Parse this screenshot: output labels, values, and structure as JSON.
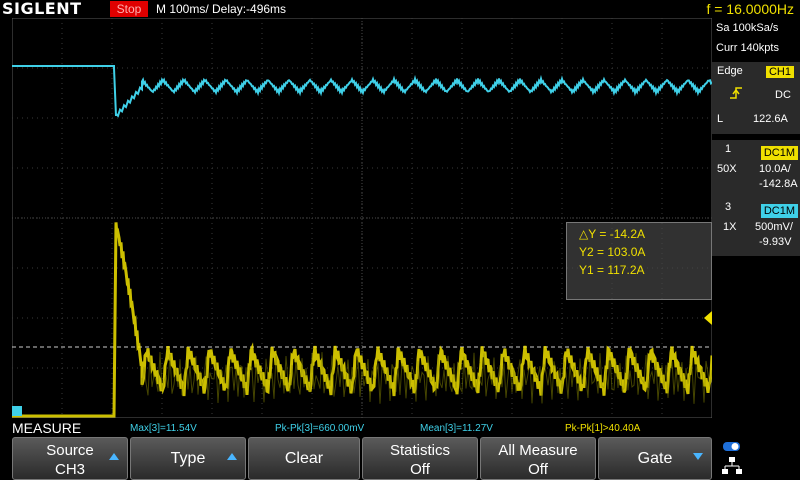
{
  "header": {
    "brand": "SIGLENT",
    "run_state": "Stop",
    "timebase": "M 100ms/  Delay:-496ms",
    "frequency": "f = 16.0000Hz"
  },
  "right_panel": {
    "sample_rate": "Sa 100kSa/s",
    "memory": "Curr 140kpts",
    "trigger": {
      "type": "Edge",
      "source": "CH1",
      "coupling": "DC",
      "level_label": "L",
      "level": "122.6A"
    },
    "ch1": {
      "number": "1",
      "coupling": "DC1M",
      "probe": "50X",
      "scale": "10.0A/",
      "offset": "-142.8A"
    },
    "ch3": {
      "number": "3",
      "coupling": "DC1M",
      "probe": "1X",
      "scale": "500mV/",
      "offset": "-9.93V"
    }
  },
  "cursor_readout": {
    "delta_y": "△Y = -14.2A",
    "y2": "Y2 = 103.0A",
    "y1": "Y1 = 117.2A"
  },
  "measure": {
    "title": "MEASURE",
    "items": [
      {
        "text": "Max[3]=11.54V",
        "color": "#3fd0e8"
      },
      {
        "text": "Pk-Pk[3]=660.00mV",
        "color": "#3fd0e8"
      },
      {
        "text": "Mean[3]=11.27V",
        "color": "#3fd0e8"
      },
      {
        "text": "Pk-Pk[1]>40.40A",
        "color": "#f0e000"
      }
    ]
  },
  "softkeys": {
    "source_label": "Source",
    "source_value": "CH3",
    "type_label": "Type",
    "clear_label": "Clear",
    "statistics_label": "Statistics",
    "statistics_value": "Off",
    "all_measure_label": "All Measure",
    "all_measure_value": "Off",
    "gate_label": "Gate"
  },
  "colors": {
    "ch1": "#3fd0e8",
    "ch3": "#f0e000",
    "stop": "#e00000",
    "accent": "#49b5ff"
  }
}
